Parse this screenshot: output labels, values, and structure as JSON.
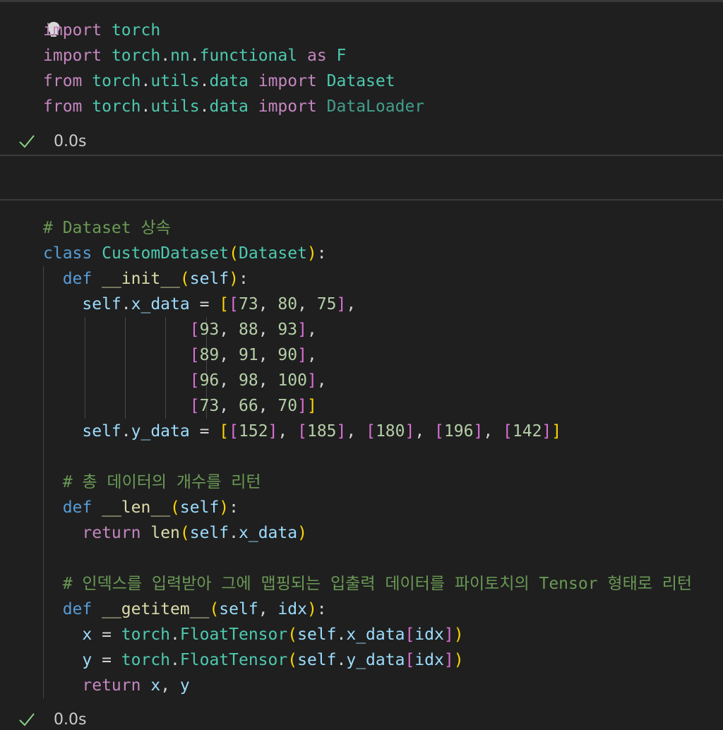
{
  "cells": [
    {
      "id": "imports-cell",
      "lines": [
        [
          [
            "kw",
            "import"
          ],
          [
            "pu",
            " "
          ],
          [
            "mod",
            "torch"
          ]
        ],
        [
          [
            "kw",
            "import"
          ],
          [
            "pu",
            " "
          ],
          [
            "mod",
            "torch"
          ],
          [
            "pu",
            "."
          ],
          [
            "mod",
            "nn"
          ],
          [
            "pu",
            "."
          ],
          [
            "mod",
            "functional"
          ],
          [
            "pu",
            " "
          ],
          [
            "kw",
            "as"
          ],
          [
            "pu",
            " "
          ],
          [
            "cls",
            "F"
          ]
        ],
        [
          [
            "kw",
            "from"
          ],
          [
            "pu",
            " "
          ],
          [
            "mod",
            "torch"
          ],
          [
            "pu",
            "."
          ],
          [
            "mod",
            "utils"
          ],
          [
            "pu",
            "."
          ],
          [
            "mod",
            "data"
          ],
          [
            "pu",
            " "
          ],
          [
            "kw",
            "import"
          ],
          [
            "pu",
            " "
          ],
          [
            "cls",
            "Dataset"
          ]
        ],
        [
          [
            "kw",
            "from"
          ],
          [
            "pu",
            " "
          ],
          [
            "mod",
            "torch"
          ],
          [
            "pu",
            "."
          ],
          [
            "mod",
            "utils"
          ],
          [
            "pu",
            "."
          ],
          [
            "mod",
            "data"
          ],
          [
            "pu",
            " "
          ],
          [
            "kw",
            "import"
          ],
          [
            "pu",
            " "
          ],
          [
            "dim",
            "DataLoader"
          ]
        ]
      ],
      "status": "0.0s"
    },
    {
      "id": "dataset-cell",
      "lines": [
        [
          [
            "cm",
            "# Dataset 상속"
          ]
        ],
        [
          [
            "kw2",
            "class"
          ],
          [
            "pu",
            " "
          ],
          [
            "cls",
            "CustomDataset"
          ],
          [
            "b1",
            "("
          ],
          [
            "cls",
            "Dataset"
          ],
          [
            "b1",
            ")"
          ],
          [
            "pu",
            ":"
          ]
        ],
        [
          [
            "pu",
            "  "
          ],
          [
            "kw2",
            "def"
          ],
          [
            "pu",
            " "
          ],
          [
            "fn",
            "__init__"
          ],
          [
            "b1",
            "("
          ],
          [
            "var",
            "self"
          ],
          [
            "b1",
            ")"
          ],
          [
            "pu",
            ":"
          ]
        ],
        [
          [
            "pu",
            "    "
          ],
          [
            "var",
            "self"
          ],
          [
            "pu",
            "."
          ],
          [
            "var",
            "x_data"
          ],
          [
            "pu",
            " = "
          ],
          [
            "b1",
            "["
          ],
          [
            "b2",
            "["
          ],
          [
            "num",
            "73"
          ],
          [
            "pu",
            ", "
          ],
          [
            "num",
            "80"
          ],
          [
            "pu",
            ", "
          ],
          [
            "num",
            "75"
          ],
          [
            "b2",
            "]"
          ],
          [
            "pu",
            ","
          ]
        ],
        [
          [
            "pu",
            "               "
          ],
          [
            "b2",
            "["
          ],
          [
            "num",
            "93"
          ],
          [
            "pu",
            ", "
          ],
          [
            "num",
            "88"
          ],
          [
            "pu",
            ", "
          ],
          [
            "num",
            "93"
          ],
          [
            "b2",
            "]"
          ],
          [
            "pu",
            ","
          ]
        ],
        [
          [
            "pu",
            "               "
          ],
          [
            "b2",
            "["
          ],
          [
            "num",
            "89"
          ],
          [
            "pu",
            ", "
          ],
          [
            "num",
            "91"
          ],
          [
            "pu",
            ", "
          ],
          [
            "num",
            "90"
          ],
          [
            "b2",
            "]"
          ],
          [
            "pu",
            ","
          ]
        ],
        [
          [
            "pu",
            "               "
          ],
          [
            "b2",
            "["
          ],
          [
            "num",
            "96"
          ],
          [
            "pu",
            ", "
          ],
          [
            "num",
            "98"
          ],
          [
            "pu",
            ", "
          ],
          [
            "num",
            "100"
          ],
          [
            "b2",
            "]"
          ],
          [
            "pu",
            ","
          ]
        ],
        [
          [
            "pu",
            "               "
          ],
          [
            "b2",
            "["
          ],
          [
            "num",
            "73"
          ],
          [
            "pu",
            ", "
          ],
          [
            "num",
            "66"
          ],
          [
            "pu",
            ", "
          ],
          [
            "num",
            "70"
          ],
          [
            "b2",
            "]"
          ],
          [
            "b1",
            "]"
          ]
        ],
        [
          [
            "pu",
            "    "
          ],
          [
            "var",
            "self"
          ],
          [
            "pu",
            "."
          ],
          [
            "var",
            "y_data"
          ],
          [
            "pu",
            " = "
          ],
          [
            "b1",
            "["
          ],
          [
            "b2",
            "["
          ],
          [
            "num",
            "152"
          ],
          [
            "b2",
            "]"
          ],
          [
            "pu",
            ", "
          ],
          [
            "b2",
            "["
          ],
          [
            "num",
            "185"
          ],
          [
            "b2",
            "]"
          ],
          [
            "pu",
            ", "
          ],
          [
            "b2",
            "["
          ],
          [
            "num",
            "180"
          ],
          [
            "b2",
            "]"
          ],
          [
            "pu",
            ", "
          ],
          [
            "b2",
            "["
          ],
          [
            "num",
            "196"
          ],
          [
            "b2",
            "]"
          ],
          [
            "pu",
            ", "
          ],
          [
            "b2",
            "["
          ],
          [
            "num",
            "142"
          ],
          [
            "b2",
            "]"
          ],
          [
            "b1",
            "]"
          ]
        ],
        [],
        [
          [
            "pu",
            "  "
          ],
          [
            "cm",
            "# 총 데이터의 개수를 리턴"
          ]
        ],
        [
          [
            "pu",
            "  "
          ],
          [
            "kw2",
            "def"
          ],
          [
            "pu",
            " "
          ],
          [
            "fn",
            "__len__"
          ],
          [
            "b1",
            "("
          ],
          [
            "var",
            "self"
          ],
          [
            "b1",
            ")"
          ],
          [
            "pu",
            ":"
          ]
        ],
        [
          [
            "pu",
            "    "
          ],
          [
            "kw",
            "return"
          ],
          [
            "pu",
            " "
          ],
          [
            "fn",
            "len"
          ],
          [
            "b1",
            "("
          ],
          [
            "var",
            "self"
          ],
          [
            "pu",
            "."
          ],
          [
            "var",
            "x_data"
          ],
          [
            "b1",
            ")"
          ]
        ],
        [],
        [
          [
            "pu",
            "  "
          ],
          [
            "cm",
            "# 인덱스를 입력받아 그에 맵핑되는 입출력 데이터를 파이토치의 Tensor 형태로 리턴"
          ]
        ],
        [
          [
            "pu",
            "  "
          ],
          [
            "kw2",
            "def"
          ],
          [
            "pu",
            " "
          ],
          [
            "fn",
            "__getitem__"
          ],
          [
            "b1",
            "("
          ],
          [
            "var",
            "self"
          ],
          [
            "pu",
            ", "
          ],
          [
            "var",
            "idx"
          ],
          [
            "b1",
            ")"
          ],
          [
            "pu",
            ":"
          ]
        ],
        [
          [
            "pu",
            "    "
          ],
          [
            "var",
            "x"
          ],
          [
            "pu",
            " = "
          ],
          [
            "mod",
            "torch"
          ],
          [
            "pu",
            "."
          ],
          [
            "cls",
            "FloatTensor"
          ],
          [
            "b1",
            "("
          ],
          [
            "var",
            "self"
          ],
          [
            "pu",
            "."
          ],
          [
            "var",
            "x_data"
          ],
          [
            "b2",
            "["
          ],
          [
            "var",
            "idx"
          ],
          [
            "b2",
            "]"
          ],
          [
            "b1",
            ")"
          ]
        ],
        [
          [
            "pu",
            "    "
          ],
          [
            "var",
            "y"
          ],
          [
            "pu",
            " = "
          ],
          [
            "mod",
            "torch"
          ],
          [
            "pu",
            "."
          ],
          [
            "cls",
            "FloatTensor"
          ],
          [
            "b1",
            "("
          ],
          [
            "var",
            "self"
          ],
          [
            "pu",
            "."
          ],
          [
            "var",
            "y_data"
          ],
          [
            "b2",
            "["
          ],
          [
            "var",
            "idx"
          ],
          [
            "b2",
            "]"
          ],
          [
            "b1",
            ")"
          ]
        ],
        [
          [
            "pu",
            "    "
          ],
          [
            "kw",
            "return"
          ],
          [
            "pu",
            " "
          ],
          [
            "var",
            "x"
          ],
          [
            "pu",
            ", "
          ],
          [
            "var",
            "y"
          ]
        ]
      ],
      "status": "0.0s"
    }
  ]
}
